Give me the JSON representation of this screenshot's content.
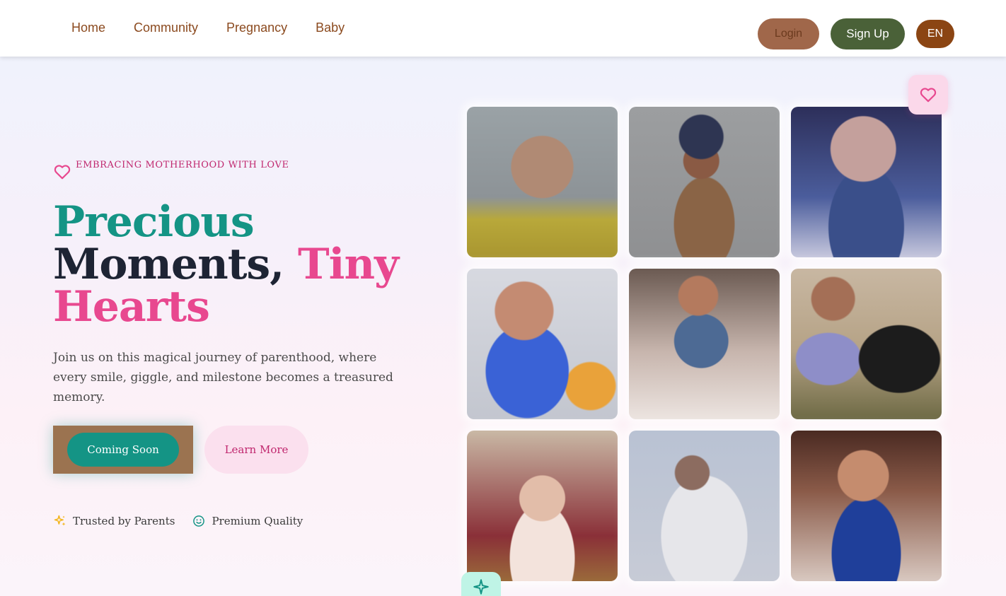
{
  "nav": {
    "items": [
      {
        "label": "Home"
      },
      {
        "label": "Community"
      },
      {
        "label": "Pregnancy"
      },
      {
        "label": "Baby"
      }
    ],
    "login_label": "Login",
    "signup_label": "Sign Up",
    "language_label": "EN"
  },
  "hero": {
    "tagline": "EMBRACING MOTHERHOOD WITH LOVE",
    "headline_part1": "Precious",
    "headline_part2": "Moments, ",
    "headline_part3": "Tiny",
    "headline_part4": "Hearts",
    "description": "Join us on this magical journey of parenthood, where every smile, giggle, and milestone becomes a treasured memory.",
    "primary_button": "Coming Soon",
    "secondary_button": "Learn More",
    "badges": [
      {
        "label": "Trusted by Parents",
        "icon": "sparkles-icon"
      },
      {
        "label": "Premium Quality",
        "icon": "smile-icon"
      }
    ]
  },
  "gallery": {
    "photos": [
      {
        "desc": "baby-yellow-shirt"
      },
      {
        "desc": "toddler-blue-hat"
      },
      {
        "desc": "baby-blue-outfit"
      },
      {
        "desc": "baby-blue-shirt-smiling"
      },
      {
        "desc": "toddler-denim-sitting"
      },
      {
        "desc": "girl-with-black-dog"
      },
      {
        "desc": "baby-headband"
      },
      {
        "desc": "child-white-blanket"
      },
      {
        "desc": "toddler-jacket"
      }
    ]
  },
  "colors": {
    "teal": "#149485",
    "pink": "#e8488f",
    "navy": "#1e2434",
    "brown": "#8b4513",
    "olive": "#4a6138"
  }
}
